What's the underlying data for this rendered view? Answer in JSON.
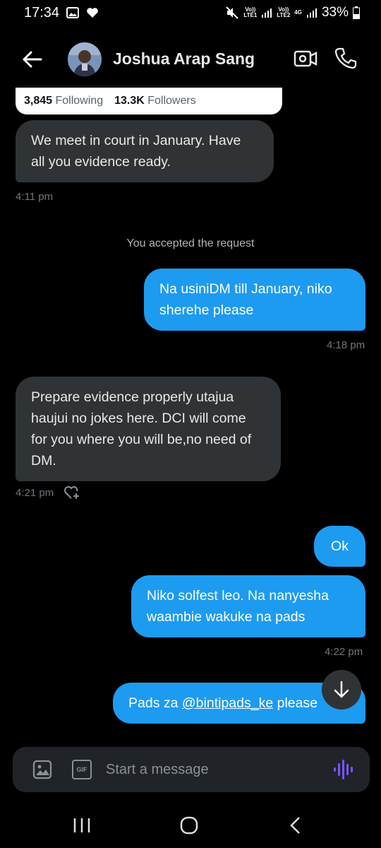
{
  "status_bar": {
    "time": "17:34",
    "net1_top": "Vo))",
    "net1_bottom": "LTE1",
    "net2_top": "Vo))",
    "net2_bottom": "LTE2",
    "net3": "4G",
    "battery": "33%"
  },
  "header": {
    "contact_name": "Joshua Arap Sang",
    "icons": [
      "back-arrow-icon",
      "video-icon",
      "phone-icon"
    ]
  },
  "profile_card": {
    "following_count": "3,845",
    "following_label": "Following",
    "followers_count": "13.3K",
    "followers_label": "Followers"
  },
  "messages": [
    {
      "direction": "in",
      "text": "We meet in court in January. Have all you evidence ready.",
      "time": "4:11 pm"
    },
    {
      "direction": "system",
      "text": "You accepted the request"
    },
    {
      "direction": "out",
      "text": "Na usiniDM till January, niko sherehe please",
      "time": "4:18 pm"
    },
    {
      "direction": "in",
      "text": "Prepare evidence properly utajua haujui no jokes here. DCI will come for you where you will be,no need of DM.",
      "time": "4:21 pm"
    },
    {
      "direction": "out",
      "text": "Ok"
    },
    {
      "direction": "out",
      "text": "Niko solfest leo.  Na nanyesha waambie wakuke na pads",
      "time": "4:22 pm"
    },
    {
      "direction": "out",
      "text_before": "Pads za ",
      "mention": "@bintipads_ke",
      "text_after": " please"
    }
  ],
  "composer": {
    "placeholder": "Start a message",
    "gif_label": "GIF"
  },
  "colors": {
    "background": "#000000",
    "incoming_bubble": "#2f3336",
    "outgoing_bubble": "#1d9bf0",
    "voice_accent": "#7856ff"
  }
}
